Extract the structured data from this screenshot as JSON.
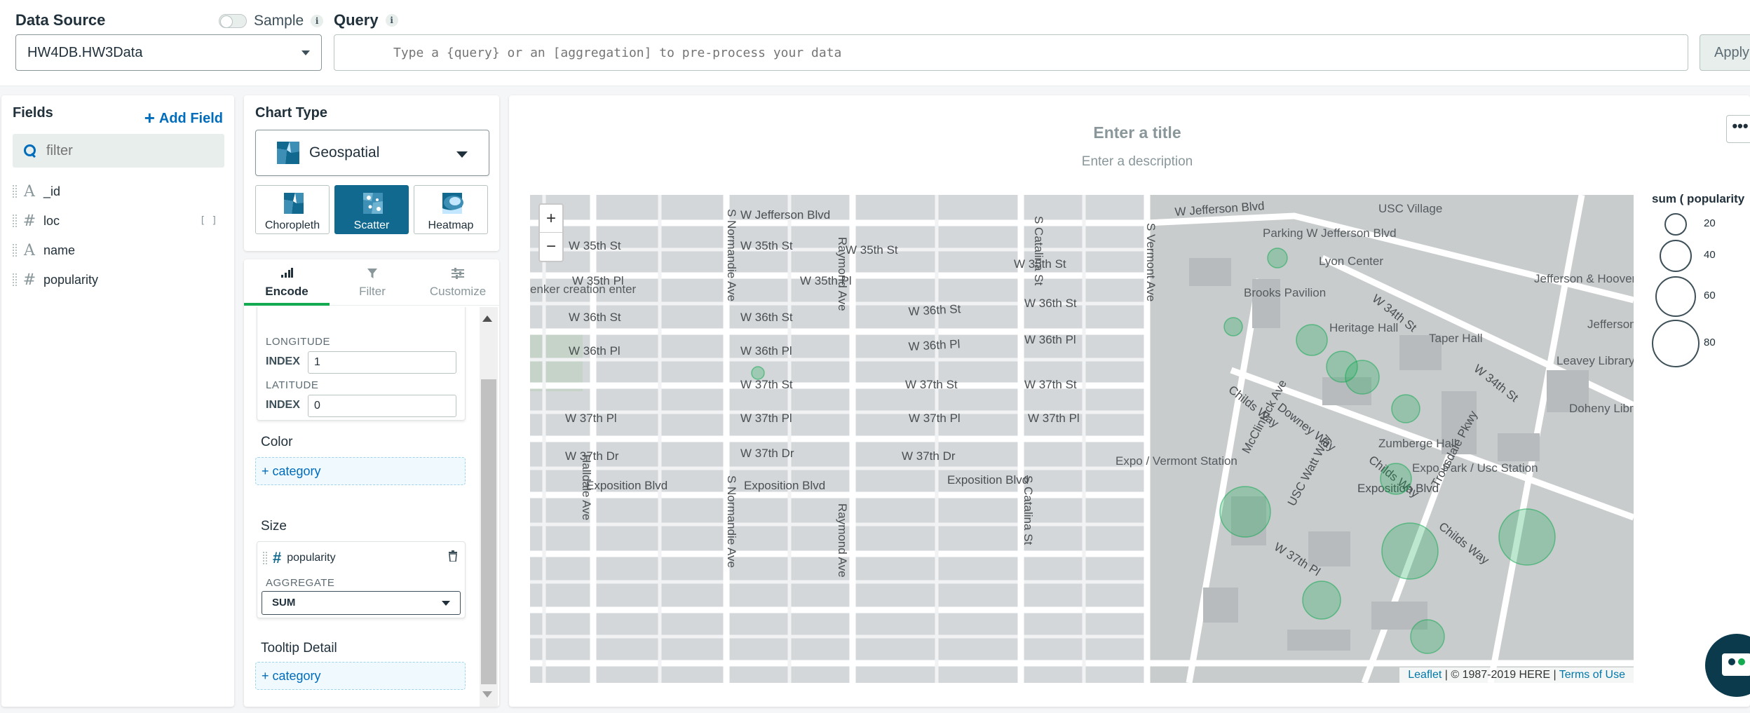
{
  "topbar": {
    "data_source_label": "Data Source",
    "sample_label": "Sample",
    "info_glyph": "i",
    "query_label": "Query",
    "data_source_value": "HW4DB.HW3Data",
    "query_placeholder": "Type a {query} or an [aggregation] to pre-process your data",
    "apply_label": "Apply"
  },
  "fields": {
    "title": "Fields",
    "add_label": "Add Field",
    "filter_placeholder": "filter",
    "items": [
      {
        "type": "A",
        "name": "_id"
      },
      {
        "type": "#",
        "name": "loc",
        "badge": "[ ]"
      },
      {
        "type": "A",
        "name": "name"
      },
      {
        "type": "#",
        "name": "popularity"
      }
    ]
  },
  "chart_type": {
    "title": "Chart Type",
    "selected": "Geospatial",
    "options": [
      "Choropleth",
      "Scatter",
      "Heatmap"
    ],
    "active": "Scatter"
  },
  "encode": {
    "tabs": [
      "Encode",
      "Filter",
      "Customize"
    ],
    "active_tab": "Encode",
    "longitude_label": "LONGITUDE",
    "latitude_label": "LATITUDE",
    "index_label": "INDEX",
    "longitude_index": "1",
    "latitude_index": "0",
    "color_title": "Color",
    "size_title": "Size",
    "tooltip_title": "Tooltip Detail",
    "category_drop": "+ category",
    "size_field": "popularity",
    "aggregate_label": "AGGREGATE",
    "aggregate_value": "SUM"
  },
  "chart": {
    "title_placeholder": "Enter a title",
    "description_placeholder": "Enter a description",
    "more_glyph": "•••",
    "zoom_in": "+",
    "zoom_out": "−",
    "attribution": {
      "leaflet": "Leaflet",
      "copyright": " | © 1987-2019 HERE | ",
      "terms": "Terms of Use"
    },
    "legend": {
      "title": "sum ( popularity",
      "values": [
        "20",
        "40",
        "60",
        "80"
      ]
    },
    "streets": [
      "W Jefferson Blvd",
      "W Jefferson Blvd",
      "W 35th St",
      "W 35th St",
      "W 35th St",
      "W 35th St",
      "W 35th Pl",
      "W 35th Pl",
      "W 36th St",
      "W 36th St",
      "W 36th St",
      "W 36th St",
      "W 36th Pl",
      "W 36th Pl",
      "W 36th Pl",
      "W 36th Pl",
      "W 37th St",
      "W 37th St",
      "W 37th St",
      "W 37th Pl",
      "W 37th Pl",
      "W 37th Pl",
      "W 37th Pl",
      "W 37th Dr",
      "W 37th Dr",
      "W 37th Dr",
      "Exposition Blvd",
      "Exposition Blvd",
      "Exposition Blvd",
      "Exposition Blvd",
      "S Normandie Ave",
      "S Normandie Ave",
      "Raymond Ave",
      "Raymond Ave",
      "S Catalina St",
      "S Catalina St",
      "S Vermont Ave",
      "Halldale Ave",
      "Childs Way",
      "Childs Way",
      "Childs Way",
      "McClintock Ave",
      "Downey Way",
      "USC Watt Way",
      "Trousdale Pkwy",
      "W 34th St",
      "W 34th St",
      "W 37th Pl"
    ],
    "places": [
      "USC Village",
      "Parking W Jefferson Blvd",
      "Lyon Center",
      "Brooks Pavilion",
      "Heritage Hall",
      "Taper Hall",
      "Jefferson & Hoover",
      "Jefferson Blvd & Figueroa S",
      "Leavey Library",
      "Doheny Library",
      "Zumberge Hall",
      "Expo / Vermont Station",
      "Expo Park / Usc Station",
      "enker creation enter"
    ]
  },
  "chart_data": {
    "type": "scatter",
    "title": "",
    "size_field": "popularity",
    "size_aggregate": "SUM",
    "marker_color": "#13aa52",
    "legend_size_values": [
      20,
      40,
      60,
      80
    ]
  }
}
